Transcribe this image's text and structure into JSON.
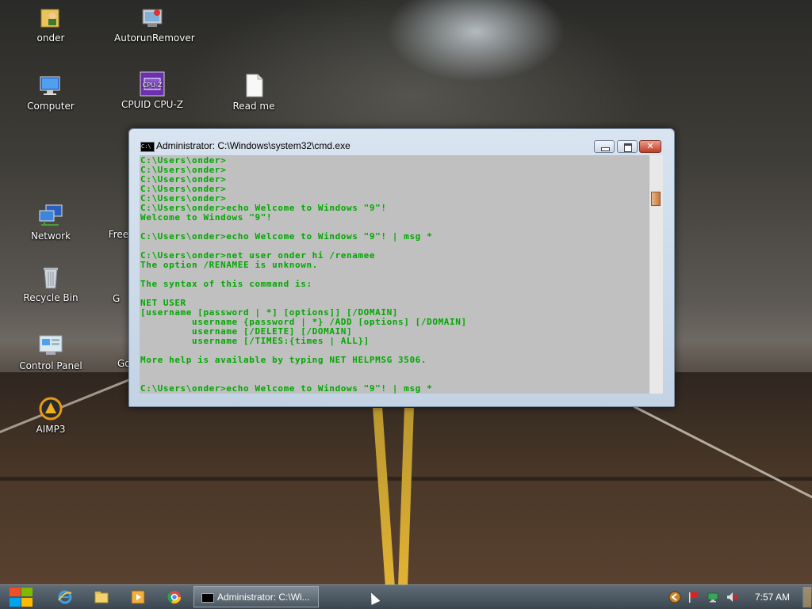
{
  "desktop": {
    "icons": [
      {
        "label": "onder",
        "icon": "user-folder-icon"
      },
      {
        "label": "AutorunRemover",
        "icon": "autorun-remover-icon"
      },
      {
        "label": "Computer",
        "icon": "computer-icon"
      },
      {
        "label": "CPUID CPU-Z",
        "icon": "cpuz-icon"
      },
      {
        "label": "Read me",
        "icon": "text-file-icon"
      },
      {
        "label": "Network",
        "icon": "network-icon"
      },
      {
        "label": "Freew",
        "icon": "partial-icon"
      },
      {
        "label": "Recycle Bin",
        "icon": "recycle-bin-icon"
      },
      {
        "label": "G",
        "icon": "partial-icon"
      },
      {
        "label": "Control Panel",
        "icon": "control-panel-icon"
      },
      {
        "label": "Go",
        "icon": "partial-icon"
      },
      {
        "label": "AIMP3",
        "icon": "aimp3-icon"
      }
    ]
  },
  "window": {
    "title": "Administrator: C:\\Windows\\system32\\cmd.exe",
    "icon_text": "C:\\",
    "console_lines": [
      "C:\\Users\\onder>",
      "C:\\Users\\onder>",
      "C:\\Users\\onder>",
      "C:\\Users\\onder>",
      "C:\\Users\\onder>",
      "C:\\Users\\onder>echo Welcome to Windows \"9\"!",
      "Welcome to Windows \"9\"!",
      "",
      "C:\\Users\\onder>echo Welcome to Windows \"9\"! | msg *",
      "",
      "C:\\Users\\onder>net user onder hi /renamee",
      "The option /RENAMEE is unknown.",
      "",
      "The syntax of this command is:",
      "",
      "NET USER",
      "[username [password | *] [options]] [/DOMAIN]",
      "         username {password | *} /ADD [options] [/DOMAIN]",
      "         username [/DELETE] [/DOMAIN]",
      "         username [/TIMES:{times | ALL}]",
      "",
      "More help is available by typing NET HELPMSG 3506.",
      "",
      "",
      "C:\\Users\\onder>echo Welcome to Windows \"9\"! | msg *"
    ],
    "console_text_color": "#00a800",
    "console_bg_color": "#c0c0c0"
  },
  "taskbar": {
    "pinned": [
      {
        "name": "internet-explorer-icon"
      },
      {
        "name": "file-explorer-icon"
      },
      {
        "name": "media-player-icon"
      },
      {
        "name": "chrome-icon"
      }
    ],
    "active_task": "Administrator: C:\\Wi...",
    "tray_icons": [
      "aimp-tray-icon",
      "flag-icon",
      "network-tray-icon",
      "volume-muted-icon"
    ],
    "clock": "7:57 AM"
  }
}
